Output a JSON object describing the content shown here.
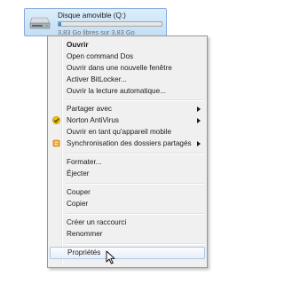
{
  "drive": {
    "name": "Disque amovible (Q:)",
    "free_text": "3,83 Go libres sur 3,83 Go",
    "fill_fraction": 0.03
  },
  "menu": {
    "items": [
      {
        "label": "Ouvrir"
      },
      {
        "label": "Open command Dos"
      },
      {
        "label": "Ouvrir dans une nouvelle fenêtre"
      },
      {
        "label": "Activer BitLocker..."
      },
      {
        "label": "Ouvrir la lecture automatique..."
      },
      {
        "label": "Partager avec"
      },
      {
        "label": "Norton AntiVirus"
      },
      {
        "label": "Ouvrir en tant qu'appareil mobile"
      },
      {
        "label": "Synchronisation des dossiers partagés"
      },
      {
        "label": "Formater..."
      },
      {
        "label": "Éjecter"
      },
      {
        "label": "Couper"
      },
      {
        "label": "Copier"
      },
      {
        "label": "Créer un raccourci"
      },
      {
        "label": "Renommer"
      },
      {
        "label": "Propriétés"
      }
    ]
  },
  "icons": {
    "drive": "removable-drive-icon",
    "norton": "norton-antivirus-icon",
    "sync": "sync-folder-icon",
    "submenu": "submenu-arrow-icon",
    "cursor": "mouse-pointer-icon"
  },
  "colors": {
    "selection_border": "#a8c8eb",
    "capacity_fill": "#1f7dc9",
    "norton_yellow": "#f2c200"
  }
}
